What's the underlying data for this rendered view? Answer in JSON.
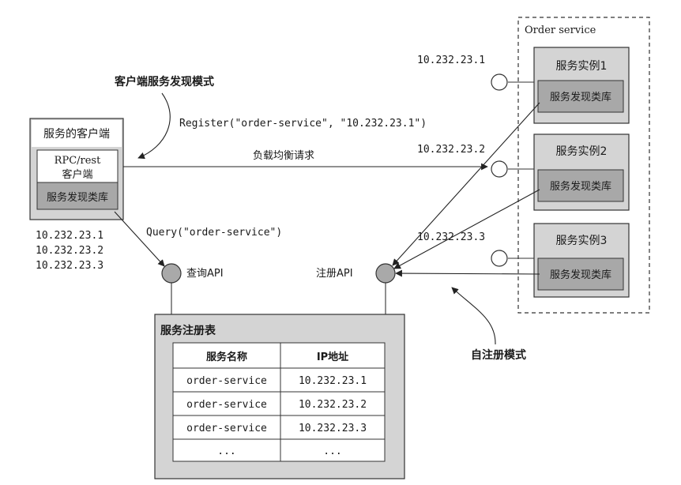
{
  "client": {
    "title": "服务的客户端",
    "rpc_line1": "RPC/rest",
    "rpc_line2": "客户端",
    "lib": "服务发现类库",
    "ips": [
      "10.232.23.1",
      "10.232.23.2",
      "10.232.23.3"
    ]
  },
  "labels": {
    "client_pattern": "客户端服务发现模式",
    "register_call": "Register(\"order-service\", \"10.232.23.1\")",
    "lb_request": "负载均衡请求",
    "query_call": "Query(\"order-service\")",
    "query_api": "查询API",
    "register_api": "注册API",
    "self_register_pattern": "自注册模式"
  },
  "order_service": {
    "title": "Order service",
    "instances": [
      {
        "name": "服务实例1",
        "lib": "服务发现类库",
        "ip": "10.232.23.1"
      },
      {
        "name": "服务实例2",
        "lib": "服务发现类库",
        "ip": "10.232.23.2"
      },
      {
        "name": "服务实例3",
        "lib": "服务发现类库",
        "ip": "10.232.23.3"
      }
    ]
  },
  "registry": {
    "title": "服务注册表",
    "headers": [
      "服务名称",
      "IP地址"
    ],
    "rows": [
      [
        "order-service",
        "10.232.23.1"
      ],
      [
        "order-service",
        "10.232.23.2"
      ],
      [
        "order-service",
        "10.232.23.3"
      ],
      [
        "...",
        "..."
      ]
    ]
  }
}
